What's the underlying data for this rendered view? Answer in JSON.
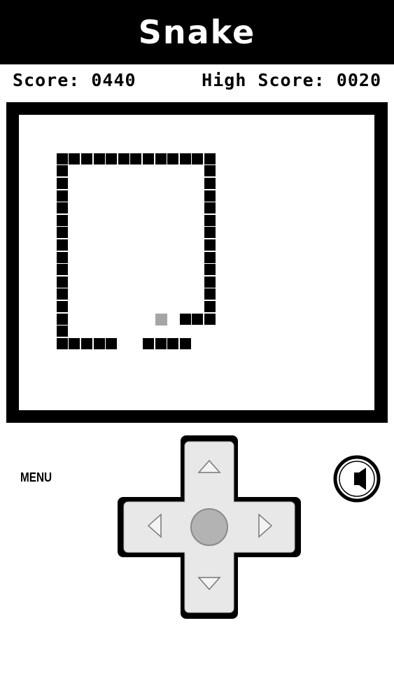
{
  "header": {
    "title": "Snake"
  },
  "scores": {
    "score_label": "Score: 0440",
    "high_score_label": "High Score: 0020"
  },
  "controls": {
    "menu_label": "MENU",
    "sound_icon": "speaker-icon",
    "dpad_icons": [
      "arrow-up-icon",
      "arrow-left-icon",
      "arrow-right-icon",
      "arrow-down-icon",
      "center-button"
    ]
  },
  "game": {
    "grid": {
      "columns": 29,
      "rows": 24
    },
    "snake": [
      [
        10,
        18
      ],
      [
        11,
        18
      ],
      [
        12,
        18
      ],
      [
        13,
        18
      ],
      [
        15,
        16
      ],
      [
        15,
        15
      ],
      [
        15,
        14
      ],
      [
        15,
        13
      ],
      [
        15,
        12
      ],
      [
        15,
        11
      ],
      [
        15,
        10
      ],
      [
        15,
        9
      ],
      [
        15,
        8
      ],
      [
        15,
        7
      ],
      [
        15,
        6
      ],
      [
        15,
        5
      ],
      [
        15,
        4
      ],
      [
        15,
        3
      ],
      [
        14,
        3
      ],
      [
        13,
        3
      ],
      [
        12,
        3
      ],
      [
        11,
        3
      ],
      [
        10,
        3
      ],
      [
        9,
        3
      ],
      [
        8,
        3
      ],
      [
        7,
        3
      ],
      [
        6,
        3
      ],
      [
        5,
        3
      ],
      [
        4,
        3
      ],
      [
        3,
        3
      ],
      [
        3,
        4
      ],
      [
        3,
        5
      ],
      [
        3,
        6
      ],
      [
        3,
        7
      ],
      [
        3,
        8
      ],
      [
        3,
        9
      ],
      [
        3,
        10
      ],
      [
        3,
        11
      ],
      [
        3,
        12
      ],
      [
        3,
        13
      ],
      [
        3,
        14
      ],
      [
        3,
        15
      ],
      [
        3,
        16
      ],
      [
        3,
        17
      ],
      [
        3,
        18
      ],
      [
        4,
        18
      ],
      [
        5,
        18
      ],
      [
        6,
        18
      ],
      [
        7,
        18
      ],
      [
        13,
        16
      ],
      [
        14,
        16
      ]
    ],
    "food": [
      11,
      16
    ],
    "colors": {
      "snake": "#000000",
      "food": "#a6a6a6",
      "board_border": "#000000"
    }
  }
}
